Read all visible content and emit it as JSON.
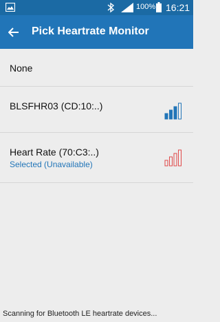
{
  "status_bar": {
    "battery_percent": "100%",
    "time": "16:21",
    "icons": [
      "gallery-icon",
      "bluetooth-icon",
      "cell-signal-icon",
      "battery-icon"
    ]
  },
  "app_bar": {
    "title": "Pick Heartrate Monitor",
    "back_icon": "arrow-left-icon"
  },
  "list": {
    "none_label": "None",
    "devices": [
      {
        "name": "BLSFHR03 (CD:10:..)",
        "status": "",
        "signal_bars": 3,
        "signal_max": 4,
        "signal_color": "#2175b8"
      },
      {
        "name": "Heart Rate (70:C3:..)",
        "status": "Selected (Unavailable)",
        "signal_bars": 0,
        "signal_max": 4,
        "signal_color": "#e04848"
      }
    ]
  },
  "footer": {
    "scan_text": "Scanning for Bluetooth LE heartrate devices..."
  },
  "colors": {
    "status_bar": "#1b6aa4",
    "app_bar": "#2175b8",
    "background": "#ededed",
    "accent": "#2175b8"
  }
}
